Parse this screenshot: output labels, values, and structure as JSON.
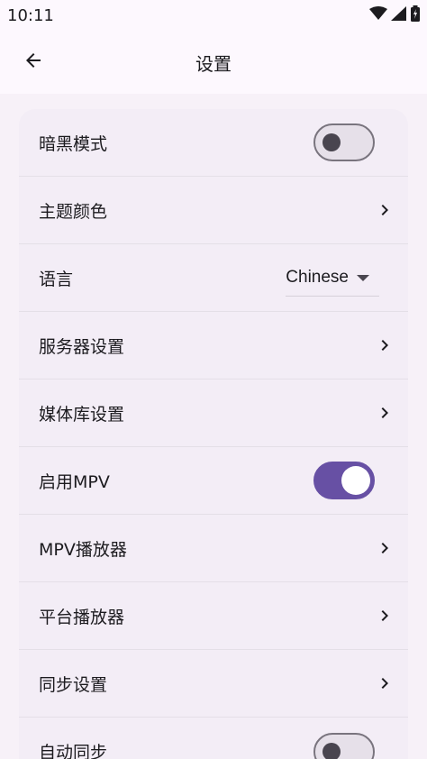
{
  "status_bar": {
    "time": "10:11",
    "icons": [
      "wifi-icon",
      "cellular-signal-icon",
      "battery-icon"
    ]
  },
  "app_bar": {
    "title": "设置",
    "back_icon": "arrow-left-icon"
  },
  "settings": {
    "items": [
      {
        "label": "暗黑模式",
        "type": "toggle",
        "on": false
      },
      {
        "label": "主题颜色",
        "type": "link"
      },
      {
        "label": "语言",
        "type": "dropdown",
        "value": "Chinese"
      },
      {
        "label": "服务器设置",
        "type": "link"
      },
      {
        "label": "媒体库设置",
        "type": "link"
      },
      {
        "label": "启用MPV",
        "type": "toggle",
        "on": true
      },
      {
        "label": "MPV播放器",
        "type": "link"
      },
      {
        "label": "平台播放器",
        "type": "link"
      },
      {
        "label": "同步设置",
        "type": "link"
      },
      {
        "label": "自动同步",
        "type": "toggle",
        "on": false
      }
    ]
  },
  "colors": {
    "accent": "#6750a4",
    "background": "#fdf8fe",
    "card": "#f3edf6",
    "text": "#1c1b1f"
  }
}
